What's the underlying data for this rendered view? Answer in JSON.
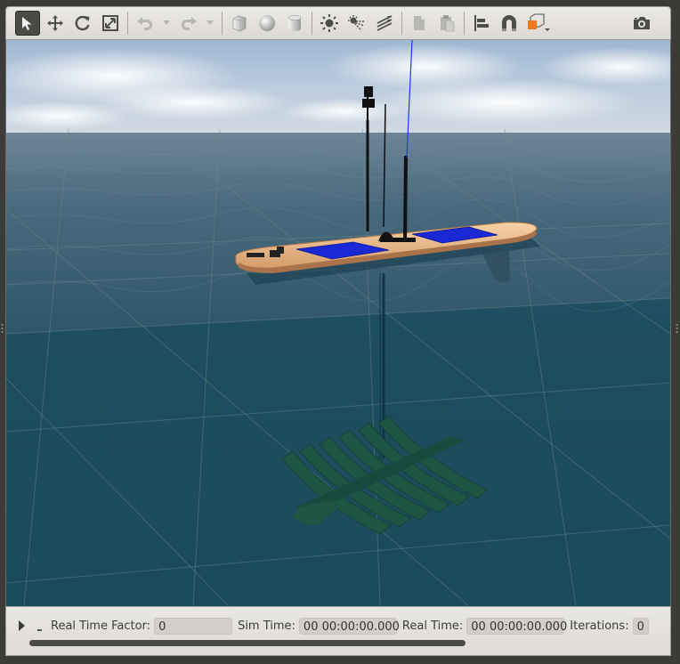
{
  "toolbar": {
    "tools": [
      "select-mode",
      "translate-mode",
      "rotate-mode",
      "scale-mode",
      "undo",
      "redo",
      "box-shape",
      "sphere-shape",
      "cylinder-shape",
      "point-light",
      "spot-light",
      "directional-light",
      "copy",
      "paste",
      "align",
      "snap",
      "view-angle",
      "screenshot"
    ]
  },
  "colors": {
    "sky": "#c7d7e6",
    "water": "#1f4f63",
    "hull": "#f2c79a",
    "solar_panel": "#1a28d6",
    "accent_orange": "#f07a1c"
  },
  "status": {
    "rtf_label": "Real Time Factor:",
    "rtf_value": "0",
    "sim_label": "Sim Time:",
    "sim_value": "00 00:00:00.000",
    "real_label": "Real Time:",
    "real_value": "00 00:00:00.000",
    "iter_label": "Iterations:",
    "iter_value": "0"
  }
}
